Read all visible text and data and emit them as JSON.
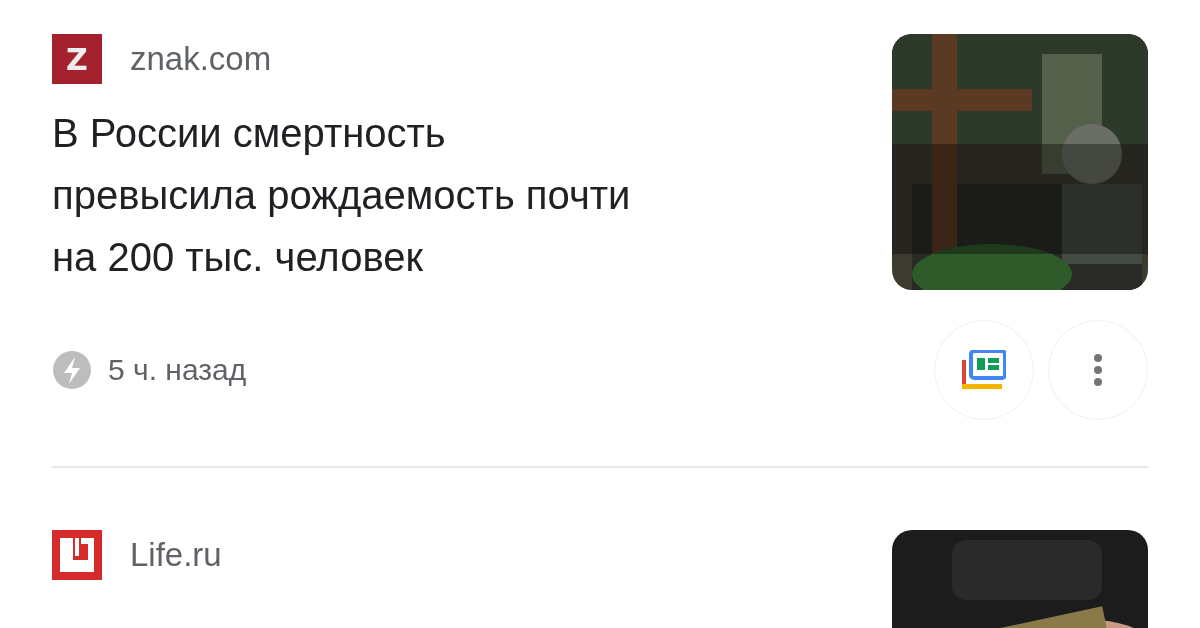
{
  "articles": [
    {
      "source": "znak.com",
      "logo": {
        "kind": "znak",
        "text": "Z"
      },
      "headline": "В России смертность превысила рождаемость почти на 200 тыс. человек",
      "time": "5 ч. назад"
    },
    {
      "source": "Life.ru",
      "logo": {
        "kind": "life"
      }
    }
  ]
}
